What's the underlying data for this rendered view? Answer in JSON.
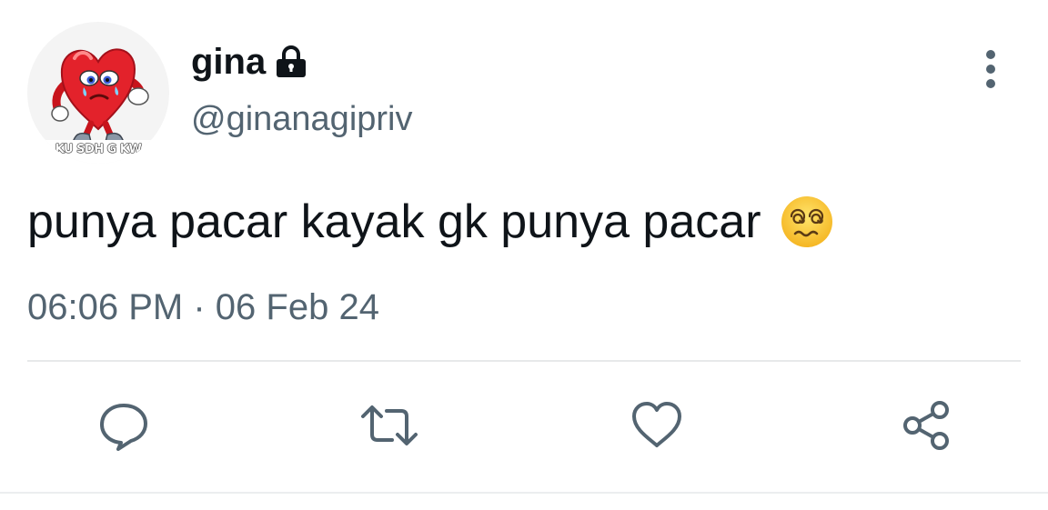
{
  "tweet": {
    "author": {
      "display_name": "gina",
      "handle": "@ginanagipriv",
      "protected": true,
      "avatar_caption": "KU SDH G KW"
    },
    "text": "punya pacar kayak gk punya pacar",
    "emoji": "dizzy-face-emoji",
    "time": "06:06 PM",
    "separator": "·",
    "date": "06 Feb 24"
  },
  "icons": {
    "lock": "lock-icon",
    "more": "more-vertical-icon",
    "reply": "reply-icon",
    "retweet": "retweet-icon",
    "like": "heart-icon",
    "share": "share-icon"
  },
  "colors": {
    "text_primary": "#0f1419",
    "text_secondary": "#536471",
    "icon": "#536471",
    "divider": "#e7e9ea"
  }
}
